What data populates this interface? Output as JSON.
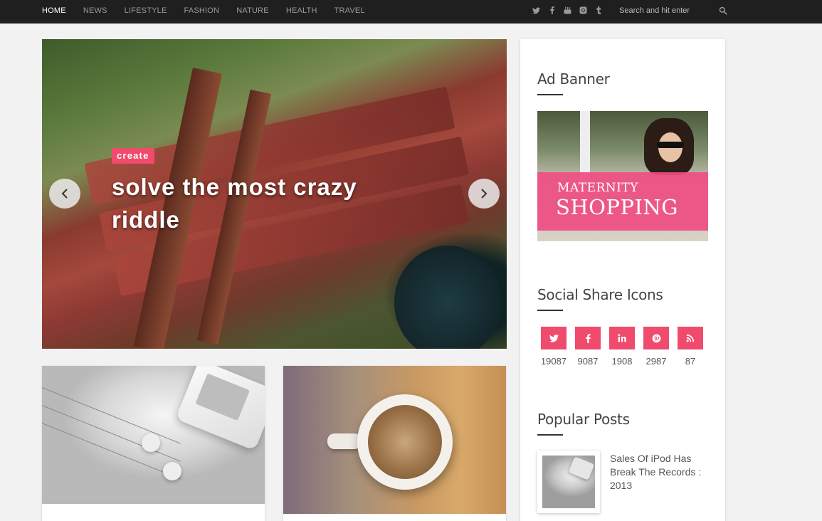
{
  "nav": {
    "items": [
      {
        "label": "HOME",
        "active": true
      },
      {
        "label": "NEWS"
      },
      {
        "label": "LIFESTYLE"
      },
      {
        "label": "FASHION"
      },
      {
        "label": "NATURE"
      },
      {
        "label": "HEALTH"
      },
      {
        "label": "TRAVEL"
      }
    ],
    "social_icons": [
      "twitter-icon",
      "facebook-icon",
      "youtube-icon",
      "instagram-icon",
      "tumblr-icon"
    ],
    "search_placeholder": "Search and hit enter"
  },
  "slider": {
    "tag": "create",
    "title": "solve the most crazy riddle"
  },
  "sidebar": {
    "ad": {
      "title": "Ad Banner",
      "banner_line1": "MATERNITY",
      "banner_line2": "SHOPPING"
    },
    "social": {
      "title": "Social Share Icons",
      "items": [
        {
          "icon": "twitter-icon",
          "count": "19087"
        },
        {
          "icon": "facebook-icon",
          "count": "9087"
        },
        {
          "icon": "linkedin-icon",
          "count": "1908"
        },
        {
          "icon": "pinterest-icon",
          "count": "2987"
        },
        {
          "icon": "rss-icon",
          "count": "87"
        }
      ]
    },
    "popular": {
      "title": "Popular Posts",
      "posts": [
        {
          "title": "Sales Of iPod Has Break The Records : 2013"
        }
      ]
    }
  },
  "colors": {
    "accent": "#f04a6d",
    "topbar": "#1f1f1f",
    "background": "#f2f2f2"
  }
}
